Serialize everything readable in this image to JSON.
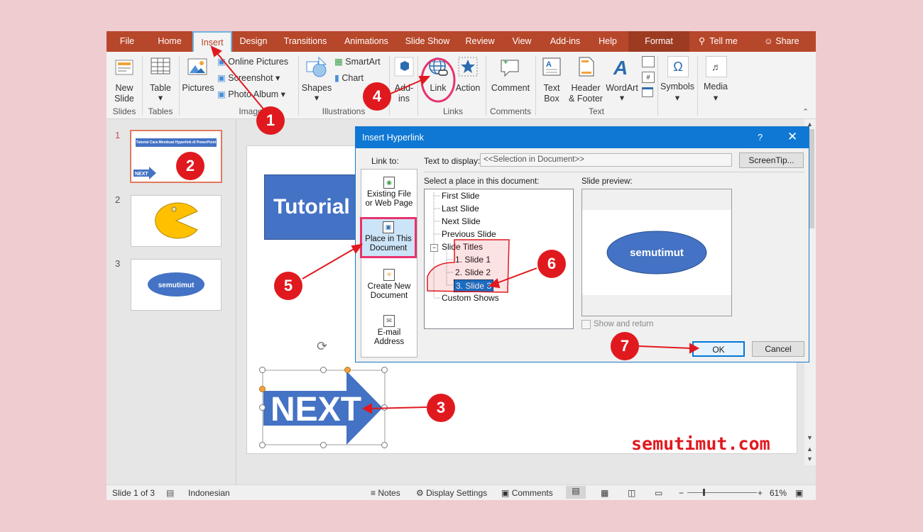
{
  "tabs": [
    {
      "label": "File"
    },
    {
      "label": "Home"
    },
    {
      "label": "Insert"
    },
    {
      "label": "Design"
    },
    {
      "label": "Transitions"
    },
    {
      "label": "Animations"
    },
    {
      "label": "Slide Show"
    },
    {
      "label": "Review"
    },
    {
      "label": "View"
    },
    {
      "label": "Add-ins"
    },
    {
      "label": "Help"
    },
    {
      "label": "Format"
    }
  ],
  "tell_me": "Tell me",
  "share": "Share",
  "ribbon": {
    "new_slide": "New",
    "new_slide2": "Slide",
    "table": "Table",
    "pictures": "Pictures",
    "online_pictures": "Online Pictures",
    "screenshot": "Screenshot",
    "photo_album": "Photo Album",
    "shapes": "Shapes",
    "smartart": "SmartArt",
    "chart": "Chart",
    "addins": "Add-",
    "addins2": "ins",
    "link": "Link",
    "action": "Action",
    "comment": "Comment",
    "text_box": "Text",
    "text_box2": "Box",
    "header_footer": "Header",
    "header_footer2": "& Footer",
    "wordart": "WordArt",
    "symbols": "Symbols",
    "media": "Media",
    "groups": {
      "slides": "Slides",
      "tables": "Tables",
      "images": "Images",
      "illustrations": "Illustrations",
      "links": "Links",
      "comments": "Comments",
      "text": "Text"
    }
  },
  "slides": {
    "n1": "1",
    "n2": "2",
    "n3": "3",
    "thumb1_title": "Tutorial Cara Membuat Hyperlink di PowerPoint",
    "thumb1_next": "NEXT",
    "thumb3_label": "semutimut"
  },
  "canvas": {
    "title": "Tutorial",
    "next": "NEXT"
  },
  "dialog": {
    "title": "Insert Hyperlink",
    "help": "?",
    "link_to": "Link to:",
    "text_to_display_label": "Text to display:",
    "text_to_display_value": "<<Selection in Document>>",
    "screentip": "ScreenTip...",
    "select_place": "Select a place in this document:",
    "slide_preview": "Slide preview:",
    "existing1": "Existing File",
    "existing2": "or Web Page",
    "place1": "Place in This",
    "place2": "Document",
    "create1": "Create New",
    "create2": "Document",
    "email1": "E-mail",
    "email2": "Address",
    "tree": {
      "first": "First Slide",
      "last": "Last Slide",
      "next": "Next Slide",
      "previous": "Previous Slide",
      "titles": "Slide Titles",
      "s1": "1. Slide 1",
      "s2": "2. Slide 2",
      "s3": "3. Slide 3",
      "custom": "Custom Shows"
    },
    "preview_label": "semutimut",
    "show_return": "Show and return",
    "ok": "OK",
    "cancel": "Cancel"
  },
  "status": {
    "slide_of": "Slide 1 of 3",
    "language": "Indonesian",
    "notes": "Notes",
    "display_settings": "Display Settings",
    "comments": "Comments",
    "zoom": "61%"
  },
  "watermark": "semutimut.com",
  "steps": {
    "s1": "1",
    "s2": "2",
    "s3": "3",
    "s4": "4",
    "s5": "5",
    "s6": "6",
    "s7": "7"
  },
  "colors": {
    "accent": "#b7472a",
    "shape_blue": "#4472c4",
    "marker_red": "#e0191f",
    "highlight_pink": "#e8336d"
  }
}
